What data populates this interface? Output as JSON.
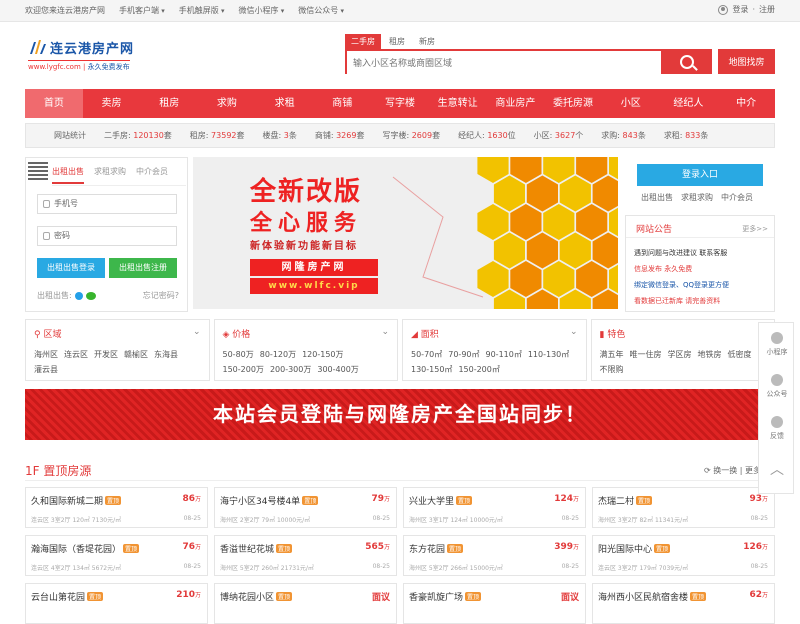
{
  "topbar": {
    "welcome": "欢迎您来连云港房产网",
    "client": "手机客户端",
    "touch": "手机触屏版",
    "mini": "微信小程序",
    "wechat": "微信公众号",
    "login": "登录",
    "sep": "·",
    "register": "注册"
  },
  "logo": {
    "name": "连云港房产网",
    "url": "www.lygfc.com",
    "slogan": "永久免费发布"
  },
  "search": {
    "tabs": [
      "二手房",
      "租房",
      "新房"
    ],
    "placeholder": "输入小区名称或商圈区域",
    "map_label": "地图找房"
  },
  "nav": [
    "首页",
    "卖房",
    "租房",
    "求购",
    "求租",
    "商铺",
    "写字楼",
    "生意转让",
    "商业房产",
    "委托房源",
    "小区",
    "经纪人",
    "中介"
  ],
  "stats": [
    {
      "label": "网站统计",
      "value": "",
      "unit": ""
    },
    {
      "label": "二手房: ",
      "value": "120130",
      "unit": "套"
    },
    {
      "label": "租房: ",
      "value": "73592",
      "unit": "套"
    },
    {
      "label": "楼盘: ",
      "value": "3",
      "unit": "条"
    },
    {
      "label": "商铺: ",
      "value": "3269",
      "unit": "套"
    },
    {
      "label": "写字楼: ",
      "value": "2609",
      "unit": "套"
    },
    {
      "label": "经纪人: ",
      "value": "1630",
      "unit": "位"
    },
    {
      "label": "小区: ",
      "value": "3627",
      "unit": "个"
    },
    {
      "label": "求购: ",
      "value": "843",
      "unit": "条"
    },
    {
      "label": "求租: ",
      "value": "833",
      "unit": "条"
    }
  ],
  "login_panel": {
    "tabs": [
      "出租出售",
      "求租求购",
      "中介会员"
    ],
    "phone_placeholder": "手机号",
    "password_placeholder": "密码",
    "login_btn": "出租出售登录",
    "register_btn": "出租出售注册",
    "foot_label": "出租出售:",
    "forgot": "忘记密码?",
    "login_color": "#29a9e3",
    "register_color": "#3db74b"
  },
  "banner": {
    "line1": "全新改版",
    "line2": "全心服务",
    "line3": "新体验新功能新目标",
    "line4": "网隆房产网",
    "line5": "www.wlfc.vip"
  },
  "right_panel": {
    "login_btn": "登录入口",
    "links": [
      "出租出售",
      "求租求购",
      "中介会员"
    ],
    "notice_title": "网站公告",
    "more": "更多>>",
    "notices": [
      "遇到问题与改进建议 联系客服",
      "信息发布 永久免费",
      "绑定微信登录、QQ登录更方便",
      "看数据已迁新库 请完善资料"
    ],
    "notice_colors": [
      "#333333",
      "#e23a3a",
      "#1a56a8",
      "#e23a3a"
    ]
  },
  "filters": [
    {
      "title": "区域",
      "items": [
        "海州区",
        "连云区",
        "开发区",
        "赣榆区",
        "东海县",
        "灌云县"
      ]
    },
    {
      "title": "价格",
      "items": [
        "50-80万",
        "80-120万",
        "120-150万",
        "150-200万",
        "200-300万",
        "300-400万"
      ]
    },
    {
      "title": "面积",
      "items": [
        "50-70㎡",
        "70-90㎡",
        "90-110㎡",
        "110-130㎡",
        "130-150㎡",
        "150-200㎡"
      ]
    },
    {
      "title": "特色",
      "items": [
        "满五年",
        "唯一住房",
        "学区房",
        "地铁房",
        "低密度",
        "不限购"
      ]
    }
  ],
  "promo": {
    "text": "本站会员登陆与网隆房产全国站同步！"
  },
  "section": {
    "title": "1F 置顶房源",
    "refresh": "换一换",
    "refresh2": "更多"
  },
  "listings": [
    {
      "name": "久和国际新城二期",
      "tag": "置顶",
      "price": "86",
      "unit": "万",
      "info": "连云区 3室2厅 120㎡ 7130元/㎡",
      "date": "08-25"
    },
    {
      "name": "海宁小区34号楼4单",
      "tag": "置顶",
      "price": "79",
      "unit": "万",
      "info": "海州区 2室2厅 79㎡ 10000元/㎡",
      "date": "08-25"
    },
    {
      "name": "兴业大学里",
      "tag": "置顶",
      "price": "124",
      "unit": "万",
      "info": "海州区 3室1厅 124㎡ 10000元/㎡",
      "date": "08-25"
    },
    {
      "name": "杰瑞二村",
      "tag": "置顶",
      "price": "93",
      "unit": "万",
      "info": "海州区 3室2厅 82㎡ 11341元/㎡",
      "date": "08-25"
    },
    {
      "name": "瀚海国际（香堤花园）",
      "tag": "置顶",
      "price": "76",
      "unit": "万",
      "info": "连云区 4室2厅 134㎡ 5672元/㎡",
      "date": "08-25"
    },
    {
      "name": "香溢世纪花城",
      "tag": "置顶",
      "price": "565",
      "unit": "万",
      "info": "海州区 5室2厅 260㎡ 21731元/㎡",
      "date": "08-25"
    },
    {
      "name": "东方花园",
      "tag": "置顶",
      "price": "399",
      "unit": "万",
      "info": "海州区 5室2厅 266㎡ 15000元/㎡",
      "date": "08-25"
    },
    {
      "name": "阳光国际中心",
      "tag": "置顶",
      "price": "126",
      "unit": "万",
      "info": "连云区 3室2厅 179㎡ 7039元/㎡",
      "date": "08-25"
    },
    {
      "name": "云台山第花园",
      "tag": "置顶",
      "price": "210",
      "unit": "万",
      "info": "",
      "date": ""
    },
    {
      "name": "博纳花园小区",
      "tag": "置顶",
      "price": "面议",
      "unit": "",
      "info": "",
      "date": ""
    },
    {
      "name": "香豪凯旋广场",
      "tag": "置顶",
      "price": "面议",
      "unit": "",
      "info": "",
      "date": ""
    },
    {
      "name": "海州西小区民航宿舍楼",
      "tag": "置顶",
      "price": "62",
      "unit": "万",
      "info": "",
      "date": ""
    }
  ],
  "side_tools": [
    "小程序",
    "公众号",
    "反馈",
    "︿"
  ],
  "colors": {
    "accent": "#e23a3a",
    "nav": "#e8383d",
    "login_blue": "#29a9e3"
  }
}
